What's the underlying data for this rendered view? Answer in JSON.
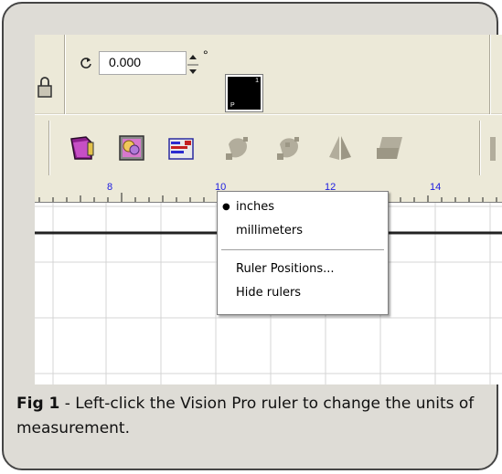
{
  "toolbar": {
    "rotation_value": "0.000",
    "degree_symbol": "°",
    "swatch_corner_top": "1",
    "swatch_corner_bottom": "P"
  },
  "ruler": {
    "tick_labels": [
      "8",
      "10",
      "12",
      "14"
    ]
  },
  "context_menu": {
    "items": [
      {
        "label": "inches",
        "selected": true
      },
      {
        "label": "millimeters",
        "selected": false
      },
      {
        "label": "Ruler Positions...",
        "selected": false
      },
      {
        "label": "Hide rulers",
        "selected": false
      }
    ],
    "selected_marker": "●"
  },
  "caption": {
    "figure_label": "Fig 1",
    "text": " - Left-click the Vision Pro ruler to change the units of measurement."
  },
  "icons": [
    "lock-icon",
    "rotate-icon",
    "spinner-icon",
    "page-icon",
    "gradient-fill-icon",
    "properties-icon",
    "node-edit-icon",
    "node-add-icon",
    "mirror-icon",
    "shape-icon"
  ]
}
